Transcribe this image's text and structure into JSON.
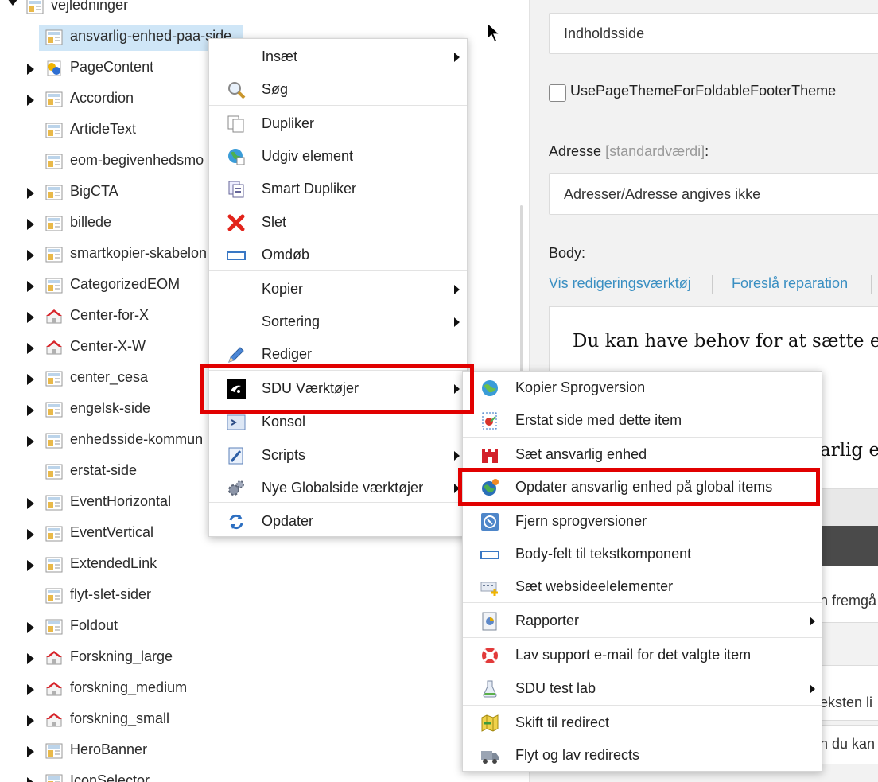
{
  "tree": {
    "root": "vejledninger",
    "selected": "ansvarlig-enhed-paa-side",
    "items": [
      "PageContent",
      "Accordion",
      "ArticleText",
      "eom-begivenhedsmo",
      "BigCTA",
      "billede",
      "smartkopier-skabelon",
      "CategorizedEOM",
      "Center-for-X",
      "Center-X-W",
      "center_cesa",
      "engelsk-side",
      "enhedsside-kommun",
      "erstat-side",
      "EventHorizontal",
      "EventVertical",
      "ExtendedLink",
      "flyt-slet-sider",
      "Foldout",
      "Forskning_large",
      "forskning_medium",
      "forskning_small",
      "HeroBanner",
      "IconSelector"
    ]
  },
  "editor": {
    "content_type_value": "Indholdsside",
    "checkbox_label": "UsePageThemeForFoldableFooterTheme",
    "address_label": "Adresse",
    "address_default": "[standardværdi]",
    "address_colon": ":",
    "address_value": "Adresser/Adresse angives ikke",
    "body_label": "Body:",
    "link_edit_tools": "Vis redigeringsværktøj",
    "link_suggest_fix": "Foreslå reparation",
    "body_text": "Du kan have behov for at sætte eller",
    "body_text_2": "arlig er",
    "fragment_1": "n fremgå",
    "fragment_2": "eksten li",
    "fragment_3": "n du kan"
  },
  "context_menu": {
    "items": [
      {
        "label": "Insæt",
        "icon": "none",
        "submenu": true
      },
      {
        "label": "Søg",
        "icon": "magnifier-icon",
        "submenu": false
      },
      {
        "label": "Dupliker",
        "icon": "duplicate-icon",
        "submenu": false
      },
      {
        "label": "Udgiv element",
        "icon": "publish-globe-icon",
        "submenu": false
      },
      {
        "label": "Smart Dupliker",
        "icon": "smart-duplicate-icon",
        "submenu": false
      },
      {
        "label": "Slet",
        "icon": "delete-x-icon",
        "submenu": false
      },
      {
        "label": "Omdøb",
        "icon": "rename-icon",
        "submenu": false
      },
      {
        "label": "Kopier",
        "icon": "none",
        "submenu": true
      },
      {
        "label": "Sortering",
        "icon": "none",
        "submenu": true
      },
      {
        "label": "Rediger",
        "icon": "pencil-icon",
        "submenu": false
      },
      {
        "label": "SDU Værktøjer",
        "icon": "sdu-logo-icon",
        "submenu": true
      },
      {
        "label": "Konsol",
        "icon": "console-icon",
        "submenu": false
      },
      {
        "label": "Scripts",
        "icon": "scripts-icon",
        "submenu": true
      },
      {
        "label": "Nye Globalside værktøjer",
        "icon": "gears-icon",
        "submenu": true
      },
      {
        "label": "Opdater",
        "icon": "refresh-icon",
        "submenu": false
      }
    ]
  },
  "sub_menu": {
    "items": [
      {
        "label": "Kopier Sprogversion",
        "icon": "language-globe-icon",
        "submenu": false
      },
      {
        "label": "Erstat side med dette item",
        "icon": "replace-page-icon",
        "submenu": false
      },
      {
        "label": "Sæt ansvarlig enhed",
        "icon": "castle-icon",
        "submenu": false
      },
      {
        "label": "Opdater ansvarlig enhed på global items",
        "icon": "globe-update-icon",
        "submenu": false
      },
      {
        "label": "Fjern sprogversioner",
        "icon": "remove-language-icon",
        "submenu": false
      },
      {
        "label": "Body-felt til tekstkomponent",
        "icon": "textfield-icon",
        "submenu": false
      },
      {
        "label": "Sæt websideelelementer",
        "icon": "web-elements-icon",
        "submenu": false
      },
      {
        "label": "Rapporter",
        "icon": "report-icon",
        "submenu": true
      },
      {
        "label": "Lav support e-mail for det valgte item",
        "icon": "lifebuoy-icon",
        "submenu": false
      },
      {
        "label": "SDU test lab",
        "icon": "flask-icon",
        "submenu": true
      },
      {
        "label": "Skift til redirect",
        "icon": "redirect-map-icon",
        "submenu": false
      },
      {
        "label": "Flyt og lav redirects",
        "icon": "truck-icon",
        "submenu": false
      }
    ]
  },
  "colors": {
    "highlight": "#e10000",
    "link": "#3a8fc2",
    "selection": "#cfe6f7"
  }
}
